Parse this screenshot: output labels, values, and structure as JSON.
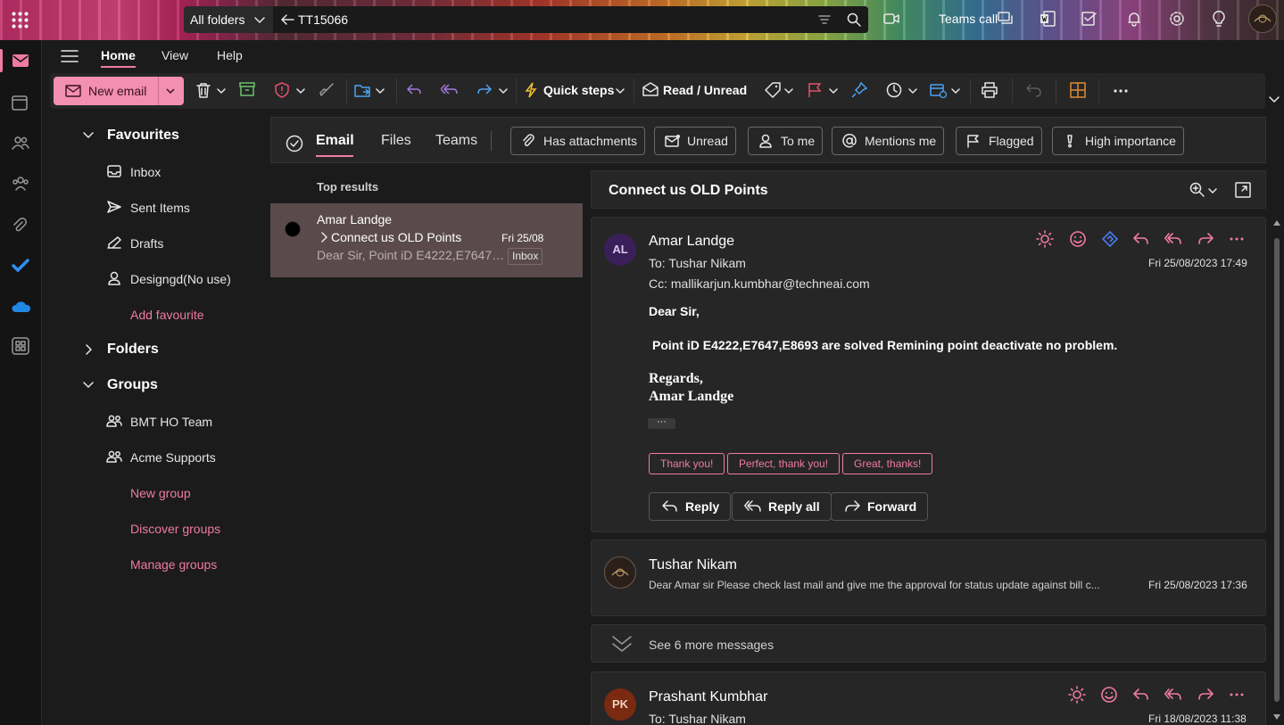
{
  "header": {
    "search_scope": "All folders",
    "search_query": "TT15066",
    "teams_call": "Teams call"
  },
  "menu": {
    "tabs": [
      "Home",
      "View",
      "Help"
    ]
  },
  "ribbon": {
    "new_email": "New email",
    "quick_steps": "Quick steps",
    "read_unread": "Read / Unread"
  },
  "nav": {
    "favourites": "Favourites",
    "inbox": "Inbox",
    "sent_items": "Sent Items",
    "drafts": "Drafts",
    "designgd": "Designgd(No use)",
    "add_favourite": "Add favourite",
    "folders": "Folders",
    "groups": "Groups",
    "group1": "BMT HO Team",
    "group2": "Acme Supports",
    "new_group": "New group",
    "discover_groups": "Discover groups",
    "manage_groups": "Manage groups"
  },
  "filters": {
    "tabs": [
      "Email",
      "Files",
      "Teams"
    ],
    "chips": [
      "Has attachments",
      "Unread",
      "To me",
      "Mentions me",
      "Flagged",
      "High importance"
    ]
  },
  "list": {
    "section": "Top results",
    "item": {
      "sender": "Amar Landge",
      "subject": "Connect us OLD Points",
      "date": "Fri 25/08",
      "preview": "Dear Sir, Point iD E4222,E7647…",
      "folder": "Inbox"
    }
  },
  "reading": {
    "subject": "Connect us OLD Points",
    "msg1": {
      "initials": "AL",
      "sender": "Amar Landge",
      "to": "To:  Tushar Nikam",
      "cc": "Cc:  mallikarjun.kumbhar@techneai.com",
      "datetime": "Fri 25/08/2023 17:49",
      "greeting": "Dear Sir,",
      "body": "Point iD E4222,E7647,E8693 are solved Remining point deactivate no problem.",
      "regards": "Regards,",
      "signature": "Amar Landge",
      "ellipsis": "···",
      "quick_replies": [
        "Thank you!",
        "Perfect, thank you!",
        "Great, thanks!"
      ],
      "reply": "Reply",
      "reply_all": "Reply all",
      "forward": "Forward"
    },
    "msg2": {
      "sender": "Tushar Nikam",
      "preview": "Dear Amar sir Please check last mail and give me the approval for status update against bill c...",
      "datetime": "Fri 25/08/2023 17:36"
    },
    "more": "See 6 more messages",
    "msg3": {
      "initials": "PK",
      "sender": "Prashant Kumbhar",
      "to": "To:  Tushar Nikam",
      "datetime": "Fri 18/08/2023 11:38"
    }
  },
  "colors": {
    "accent": "#f07ba0",
    "new_email_bg": "#f38fb0",
    "selected_row": "#5a4a4c",
    "avatar_al": "#3b1f5a",
    "avatar_pk": "#7a2a10"
  }
}
